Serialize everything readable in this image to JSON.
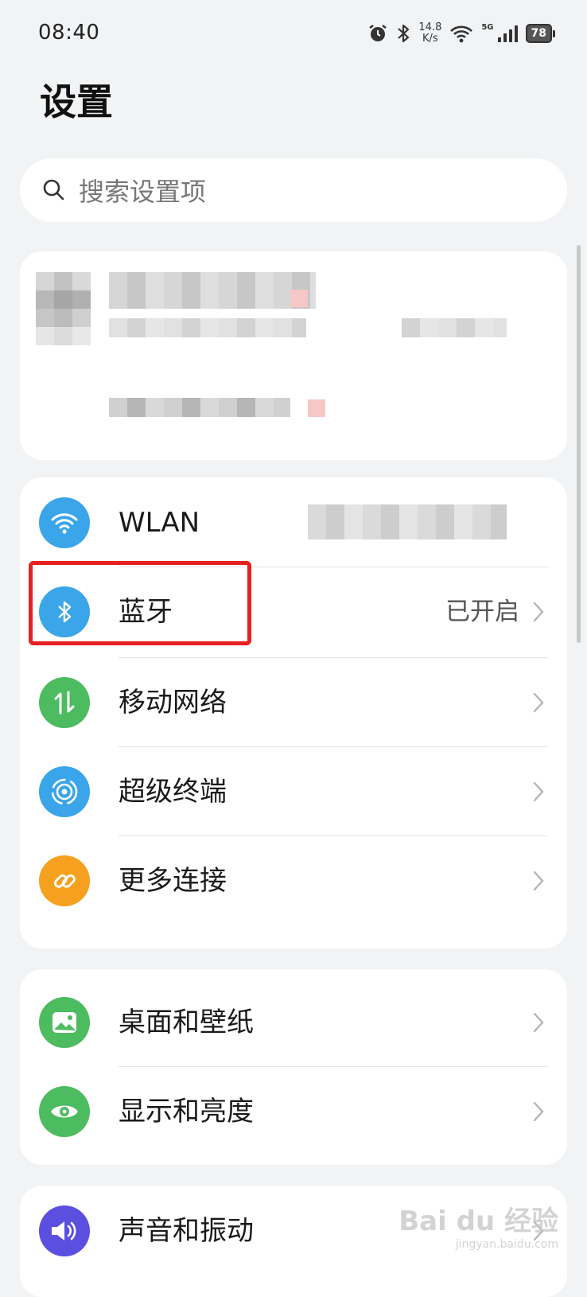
{
  "status_bar": {
    "time": "08:40",
    "speed_value": "14.8",
    "speed_unit": "K/s",
    "network": "5G",
    "battery": "78",
    "icons": [
      "alarm-icon",
      "bluetooth-icon",
      "wifi-icon",
      "signal-icon",
      "battery-icon"
    ]
  },
  "page": {
    "title": "设置"
  },
  "search": {
    "placeholder": "搜索设置项"
  },
  "connections": [
    {
      "label": "WLAN",
      "value": "",
      "icon": "wifi-icon",
      "color": "#3aa5e8"
    },
    {
      "label": "蓝牙",
      "value": "已开启",
      "icon": "bluetooth-icon",
      "color": "#3aa5e8"
    },
    {
      "label": "移动网络",
      "value": "",
      "icon": "mobile-data-icon",
      "color": "#4dbb5f"
    },
    {
      "label": "超级终端",
      "value": "",
      "icon": "super-device-icon",
      "color": "#3aa5e8"
    },
    {
      "label": "更多连接",
      "value": "",
      "icon": "link-icon",
      "color": "#f5a11f"
    }
  ],
  "display": [
    {
      "label": "桌面和壁纸",
      "icon": "wallpaper-icon",
      "color": "#4dbb5f"
    },
    {
      "label": "显示和亮度",
      "icon": "eye-icon",
      "color": "#4dbb5f"
    }
  ],
  "sound": [
    {
      "label": "声音和振动",
      "icon": "speaker-icon",
      "color": "#5b4fe0"
    }
  ],
  "watermark": {
    "brand": "Bai du 经验",
    "url": "jingyan.baidu.com"
  }
}
